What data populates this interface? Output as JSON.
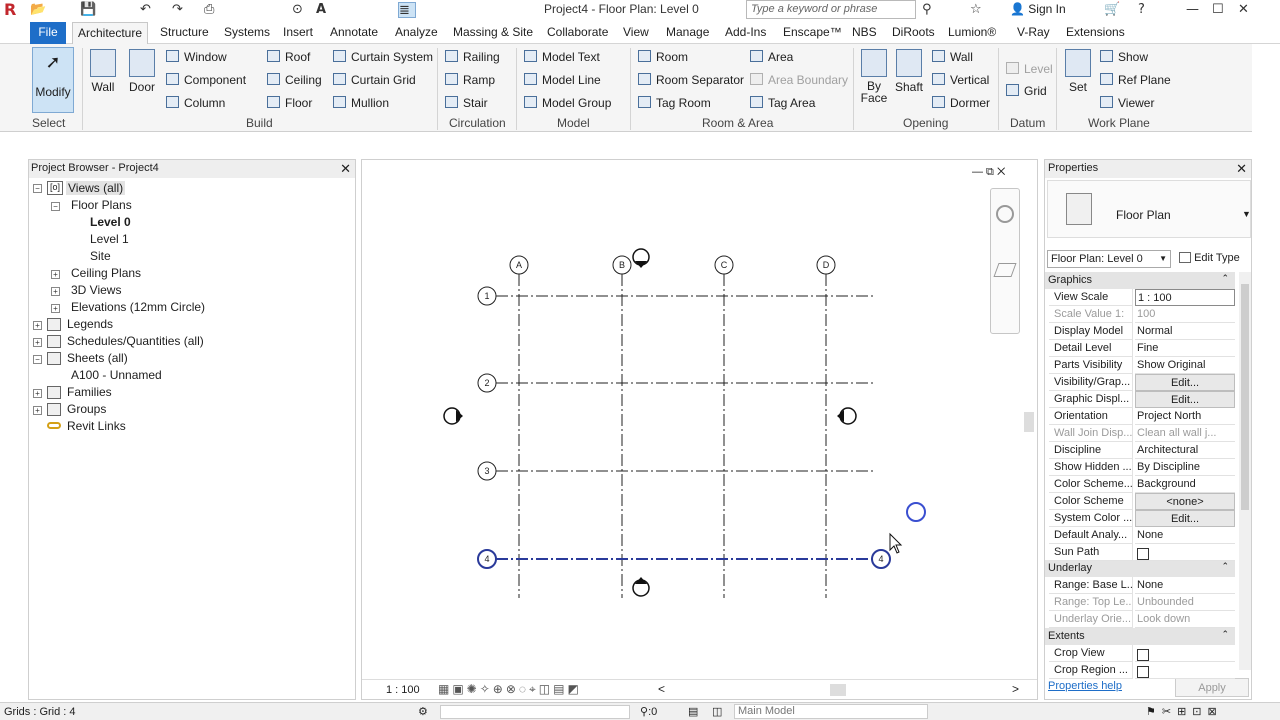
{
  "window": {
    "title": "Project4 - Floor Plan: Level 0",
    "search_placeholder": "Type a keyword or phrase",
    "sign_in": "Sign In"
  },
  "tabs": [
    "File",
    "Architecture",
    "Structure",
    "Systems",
    "Insert",
    "Annotate",
    "Analyze",
    "Massing & Site",
    "Collaborate",
    "View",
    "Manage",
    "Add-Ins",
    "Enscape™",
    "NBS",
    "DiRoots",
    "Lumion®",
    "V-Ray",
    "Extensions"
  ],
  "ribbon": {
    "modify": "Modify",
    "select": "Select",
    "wall": "Wall",
    "door": "Door",
    "build_items": [
      "Window",
      "Component",
      "Column",
      "Roof",
      "Ceiling",
      "Floor",
      "Curtain System",
      "Curtain Grid",
      "Mullion"
    ],
    "circulation_items": [
      "Railing",
      "Ramp",
      "Stair"
    ],
    "model_items": [
      "Model Text",
      "Model Line",
      "Model Group"
    ],
    "room_items": [
      "Room",
      "Room Separator",
      "Tag Room",
      "Area",
      "Area Boundary",
      "Tag Area"
    ],
    "opening_items": [
      "By Face",
      "Shaft",
      "Wall",
      "Vertical",
      "Dormer"
    ],
    "datum_items": [
      "Level",
      "Grid"
    ],
    "workplane_items": [
      "Set",
      "Show",
      "Ref Plane",
      "Viewer"
    ],
    "panels": [
      "Select",
      "Build",
      "Circulation",
      "Model",
      "Room & Area",
      "Opening",
      "Datum",
      "Work Plane"
    ]
  },
  "project_browser": {
    "title": "Project Browser - Project4",
    "tree": [
      "Views (all)",
      "Floor Plans",
      "Level 0",
      "Level 1",
      "Site",
      "Ceiling Plans",
      "3D Views",
      "Elevations (12mm Circle)",
      "Legends",
      "Schedules/Quantities (all)",
      "Sheets (all)",
      "A100 - Unnamed",
      "Families",
      "Groups",
      "Revit Links"
    ]
  },
  "canvas": {
    "grid_columns": [
      "A",
      "B",
      "C",
      "D"
    ],
    "grid_rows": [
      "1",
      "2",
      "3",
      "4"
    ],
    "scale": "1 : 100"
  },
  "properties": {
    "title": "Properties",
    "type_name": "Floor Plan",
    "selector": "Floor Plan: Level 0",
    "edit_type": "Edit Type",
    "sections": {
      "graphics": "Graphics",
      "underlay": "Underlay",
      "extents": "Extents"
    },
    "graphics": [
      {
        "k": "View Scale",
        "v": "1 : 100"
      },
      {
        "k": "Scale Value    1:",
        "v": "100"
      },
      {
        "k": "Display Model",
        "v": "Normal"
      },
      {
        "k": "Detail Level",
        "v": "Fine"
      },
      {
        "k": "Parts Visibility",
        "v": "Show Original"
      },
      {
        "k": "Visibility/Grap...",
        "v": "Edit..."
      },
      {
        "k": "Graphic Displ...",
        "v": "Edit..."
      },
      {
        "k": "Orientation",
        "v": "Project North"
      },
      {
        "k": "Wall Join Disp...",
        "v": "Clean all wall j..."
      },
      {
        "k": "Discipline",
        "v": "Architectural"
      },
      {
        "k": "Show Hidden ...",
        "v": "By Discipline"
      },
      {
        "k": "Color Scheme...",
        "v": "Background"
      },
      {
        "k": "Color Scheme",
        "v": "<none>"
      },
      {
        "k": "System Color ...",
        "v": "Edit..."
      },
      {
        "k": "Default Analy...",
        "v": "None"
      },
      {
        "k": "Sun Path",
        "v": ""
      }
    ],
    "underlay": [
      {
        "k": "Range: Base L...",
        "v": "None"
      },
      {
        "k": "Range: Top Le...",
        "v": "Unbounded"
      },
      {
        "k": "Underlay Orie...",
        "v": "Look down"
      }
    ],
    "extents": [
      {
        "k": "Crop View",
        "v": ""
      },
      {
        "k": "Crop Region ...",
        "v": ""
      }
    ],
    "help": "Properties help",
    "apply": "Apply"
  },
  "status": {
    "left": "Grids : Grid : 4",
    "count": ":0",
    "model": "Main Model"
  },
  "colors": {
    "accent": "#1e6ec8",
    "selected": "#2a3a9a"
  }
}
